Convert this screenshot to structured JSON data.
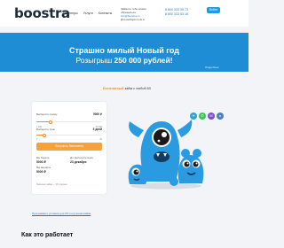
{
  "header": {
    "logo": "boostra",
    "nav": [
      "Партнеры",
      "Услуги",
      "Контакты"
    ],
    "contact_line1": "Займите тебе можно обращаться",
    "contact_mail": "info@boostra.ru",
    "contact_line3": "Для выбора поля в",
    "phones": [
      "8 800 333 30 73",
      "8 800 333 53 16"
    ],
    "login_label": "Войти"
  },
  "banner": {
    "title": "Страшно милый Новый год",
    "subtitle_prefix": "Розыгрыш",
    "subtitle_amount": "250 000 рублей!",
    "note": "Подробнее"
  },
  "promo": {
    "highlight": "Бесплатный",
    "rest": "займ с любой 60"
  },
  "calculator": {
    "amount_label": "Выберите сумму",
    "amount_value": "5000 ₽",
    "amount_fraction": 0.22,
    "amount_ticks": [
      "1 000",
      "30 000"
    ],
    "term_label": "Выберите срок",
    "term_value": "5 дней",
    "term_fraction": 0.12,
    "term_ticks": [
      "5",
      "30"
    ],
    "cta_label": "Получить бесплатно",
    "you_take_label": "Вы берёте",
    "you_take_value": "5000 ₽",
    "return_label": "Вы вернёте",
    "return_value": "5000 ₽",
    "until_label": "До (включительно)",
    "until_value": "23 декабря",
    "note": "Значение займа — 0% годовых"
  },
  "footer_link": "Программа и условия для 0% получения займа",
  "social": [
    {
      "icon": "telegram-icon",
      "glyph": "✈",
      "color": "#2ba3dc"
    },
    {
      "icon": "whatsapp-icon",
      "glyph": "✆",
      "color": "#3cc35a"
    },
    {
      "icon": "viber-icon",
      "glyph": "☏",
      "color": "#7b4fd1"
    },
    {
      "icon": "vk-icon",
      "glyph": "в",
      "color": "#4a7fc1"
    }
  ],
  "section": {
    "title": "Как это работает"
  },
  "colors": {
    "brand_blue": "#1e8dd6",
    "accent_orange": "#f08d1e",
    "mascot_blue": "#2a9be0"
  }
}
